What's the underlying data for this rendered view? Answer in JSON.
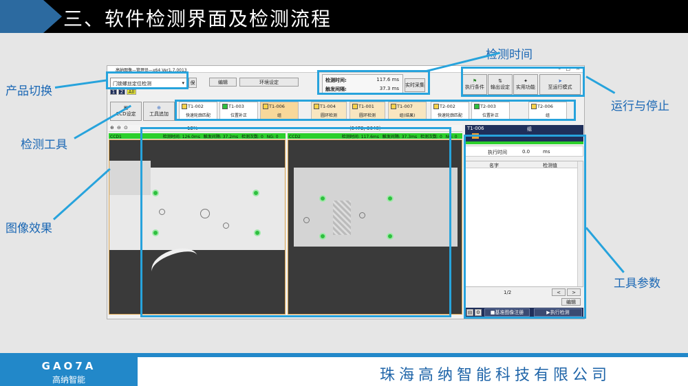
{
  "slide": {
    "title": "三、软件检测界面及检测流程",
    "company": "珠海高纳智能科技有限公司",
    "logo_en": "GAO7A",
    "logo_cn": "高纳智能"
  },
  "annotations": {
    "product_switch": "产品切换",
    "detect_tool": "检测工具",
    "image_effect": "图像效果",
    "detect_time": "检测时间",
    "run_stop": "运行与停止",
    "tool_params": "工具参数"
  },
  "app": {
    "window_title": "高纳图像—管理员—x64 Ver1.7.0013",
    "product_select": "门锁螺丝定位检测",
    "product_btn": "保",
    "edit_menu": "编辑",
    "env_menu": "环境设定",
    "time_label_1": "检测时间:",
    "time_value_1": "117.6 ms",
    "time_label_2": "触发间隔:",
    "time_value_2": "37.3 ms",
    "realtime_btn": "实时采集",
    "top_buttons": [
      "执行条件",
      "输出设定",
      "实用功能",
      "至运行模式"
    ],
    "small_tags": [
      "1",
      "2",
      "All"
    ],
    "ccd_btn": "CCD设定",
    "tool_add_btn": "工具追加",
    "tools": [
      {
        "id": "T1-002",
        "name": "快速轮廓匹配"
      },
      {
        "id": "T1-003",
        "name": "位置补正"
      },
      {
        "id": "T1-006",
        "name": "组"
      },
      {
        "id": "T1-004",
        "name": "圆环检测"
      },
      {
        "id": "T1-001",
        "name": "圆环检测"
      },
      {
        "id": "T1-007",
        "name": "组(结果)"
      },
      {
        "id": "T2-002",
        "name": "快速轮廓匹配"
      },
      {
        "id": "T2-003",
        "name": "位置补正"
      },
      {
        "id": "T2-006",
        "name": "组"
      }
    ],
    "zoom": "12%",
    "coords": "(5472, 3648)",
    "ccd1": {
      "name": "CCD1",
      "time_label": "检测时间:",
      "time": "126.0ms",
      "trig_label": "触发间隔:",
      "trig": "37.2ms",
      "count_label": "检测次数:",
      "count": "0",
      "ng_label": "NG:",
      "ng": "0"
    },
    "ccd2": {
      "name": "CCD2",
      "time_label": "检测时间:",
      "time": "117.6ms",
      "trig_label": "触发间隔:",
      "trig": "37.3ms",
      "count_label": "检测次数:",
      "count": "0",
      "ng_label": "NG:",
      "ng": "0"
    },
    "panel": {
      "tool_id": "T1-006",
      "tool_name": "组",
      "exec_time_label": "执行时间",
      "exec_time": "0.0",
      "exec_unit": "ms",
      "col_name": "名字",
      "col_value": "检测值",
      "page": "1/2",
      "prev": "<",
      "next": ">",
      "edit_btn": "编辑",
      "register_btn": "基准图像注册",
      "exec_btn": "执行检测"
    }
  },
  "colors": {
    "accent": "#27a3dc",
    "status_green": "#2ccf2c",
    "title_bar": "#1f2f5a"
  }
}
